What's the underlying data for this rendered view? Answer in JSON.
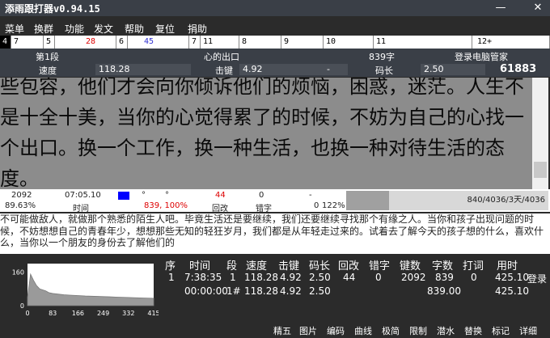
{
  "app": {
    "title": "添雨跟打器v0.94.15"
  },
  "menu": [
    "菜单",
    "换群",
    "功能",
    "发文",
    "帮助",
    "复位",
    "捐助"
  ],
  "scorebar": [
    "4",
    "7",
    "5",
    "28",
    "6",
    "45",
    "7",
    "11",
    "8",
    "9",
    "10",
    "11",
    "12+"
  ],
  "info": {
    "segment": "第1段",
    "article_title": "心的出口",
    "char_count": "839字",
    "user": "登录电脑管家",
    "speed_label": "速度",
    "speed_value": "118.28",
    "keystroke_label": "击键",
    "keystroke_value": "4.92",
    "dash": "-",
    "code_len_label": "码长",
    "code_len_value": "2.50",
    "score": "61883"
  },
  "article": "些包容，他们才会向你倾诉他们的烦恼，困惑，迷茫。人生不是十全十美，当你的心觉得累了的时候，不妨为自己的心找一个出口。换一个工作，换一种生活，也换一种对待生活的态度。",
  "status": {
    "count": "2092",
    "percent": "89.63%",
    "time": "07:05.10",
    "time_label": "时间",
    "degree": "°",
    "total": "839, 100%",
    "backspace": "44",
    "backspace_label": "回改",
    "error": "0",
    "error_label": "错字",
    "dash2": "-",
    "zero": "0",
    "rate": "122%",
    "progress_text": "840/4036/3天/4036",
    "progress_fraction": 0.21
  },
  "typed": "不可能做敌人，就做那个熟悉的陌生人吧。毕竟生活还是要继续，我们还要继续寻找那个有缘之人。当你和孩子出现问题的时候，不妨想想自己的青春年少，想想那些无知的轻狂岁月，我们都是从年轻走过来的。试着去了解今天的孩子想的什么，喜欢什么，当你以一个朋友的身份去了解他们的",
  "chart": {
    "yticks": [
      "160",
      "0"
    ],
    "xticks": [
      "0",
      "83",
      "166",
      "249",
      "332",
      "415"
    ]
  },
  "chart_data": {
    "type": "area",
    "x": [
      0,
      10,
      20,
      30,
      40,
      50,
      60,
      70,
      83,
      100,
      120,
      140,
      166,
      190,
      210,
      230,
      249,
      270,
      290,
      310,
      332,
      350,
      370,
      390,
      415
    ],
    "values": [
      40,
      150,
      120,
      95,
      80,
      75,
      70,
      62,
      58,
      55,
      52,
      50,
      48,
      46,
      45,
      44,
      43,
      42,
      41,
      40,
      39,
      38,
      37,
      36,
      35
    ],
    "xlim": [
      0,
      415
    ],
    "ylim": [
      0,
      200
    ]
  },
  "table": {
    "headers": [
      "序",
      "时间",
      "段",
      "速度",
      "击键",
      "码长",
      "回改",
      "错字",
      "键数",
      "字数",
      "打词",
      "用时"
    ],
    "rows": [
      [
        "1",
        "7:38:35",
        "1",
        "118.28",
        "4.92",
        "2.50",
        "44",
        "0",
        "2092",
        "839",
        "0",
        "425.10",
        "登录"
      ],
      [
        "",
        "00:00:00",
        "1#",
        "118.28",
        "4.92",
        "2.50",
        "",
        "",
        "",
        "839.00",
        "",
        "425.10",
        ""
      ]
    ]
  },
  "toolbar": [
    "精五",
    "图片",
    "编码",
    "曲线",
    "极简",
    "限制",
    "潜水",
    "替换",
    "标记",
    "详细"
  ],
  "colors": {
    "accent_green": "#2ecc40",
    "accent_red": "#ff3b3b",
    "accent_yellow": "#f0d000"
  }
}
